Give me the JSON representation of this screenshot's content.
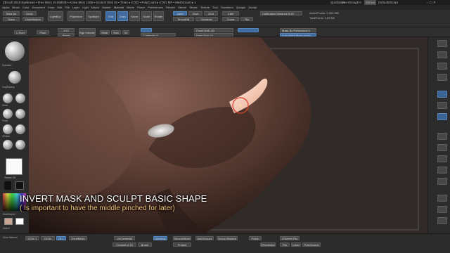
{
  "titlebar": {
    "text": "ZBrush 2018   Eyebrows   • Free Mem 16.698GB • Active Mem 1366 • Scratch Disk 46 • Timer ▸ 0.002 • PolyCount ▸ 0.061 MP • MeshCount ▸ 1",
    "quicksave": "QuickSave",
    "seethrough": "See-through 0",
    "menus_btn": "Menus",
    "script": "DefaultZScript"
  },
  "menus": [
    "Alpha",
    "Brush",
    "Color",
    "Document",
    "Draw",
    "Edit",
    "File",
    "Layer",
    "Light",
    "Macro",
    "Marker",
    "Material",
    "Movie",
    "Picker",
    "Preferences",
    "Render",
    "Stencil",
    "Stroke",
    "Texture",
    "Tool",
    "Transform",
    "Zplugin",
    "Zscript"
  ],
  "topshelf": {
    "saveas": "Save As",
    "open": "Open",
    "undo": "Undo",
    "undohist": "UndoHistory",
    "lightbox": "LightBox",
    "projection": "Projection",
    "spotlight": "Spotlight",
    "edit": "Edit",
    "draw": "Draw",
    "move": "Move",
    "scale": "Scale",
    "rotate": "Rotate",
    "zadd": "Zadd",
    "zsub": "Zsub",
    "zcut": "Zcut",
    "focal_shift": "Focal Shift -50",
    "draw_size": "Draw Size 16",
    "intensity": "Z Intensity 8",
    "smooth": "SmoothB",
    "dynamic": "Dynamic",
    "active_points": "ActivePoints: 3,952,380",
    "total_points": "TotalPoints: 3,83 Mil",
    "calibration": "Calibration Distance 8.25",
    "cam": "Cam",
    "curve": "Curve",
    "flip": "Flip"
  },
  "secondshelf": {
    "xyz": "XYZ",
    "floor": "Floor",
    "lsym": "L.Sym",
    "reset": "Reset",
    "rgb": "Rgb",
    "mrgb": "Mrgb",
    "m": "M",
    "intensity": "Rgb Intensity 100",
    "target": "Mask By Polygroups 0",
    "pinch": "Auto Mask Mesh Insert"
  },
  "leftpanel": {
    "tools": [
      "Standard",
      "ClayBuildup",
      "Move",
      "Inflate",
      "Pinch",
      "DamStandard",
      "hPolish",
      "TrimDynamic",
      "Slash3"
    ],
    "texture_caption": "Texture Off",
    "material_caption": "SkinShade4",
    "alpha_caption": "Alpha Off",
    "colors": {
      "main": "#c9a58f",
      "secondary": "#ffffff"
    },
    "switch": "Switch",
    "clear": "Clear Material"
  },
  "viewport": {
    "skin_light": "#7a5549",
    "skin_dark": "#2a1c18",
    "bg": "#2f2b28",
    "mask_highlight": "#f5d0b8"
  },
  "captions": {
    "main": "INVERT MASK AND SCULPT BASIC SHAPE",
    "sub": "( Is important to have the middle pinched for later)"
  },
  "bottombar": {
    "items": [
      "DClip 1",
      "QClip",
      "Qt 1",
      "DynaMesh",
      "UnCreaseAll",
      "SmoothMesh",
      "AutoGroups",
      "Group Masked",
      "Polish",
      "ZSphere Rig",
      "ZRemesher",
      "Dynamic",
      "CreaseLvl 15",
      "Brush",
      "Project",
      "Flip",
      "Layer",
      "PolyGroups"
    ],
    "clear": "Clear Material"
  }
}
